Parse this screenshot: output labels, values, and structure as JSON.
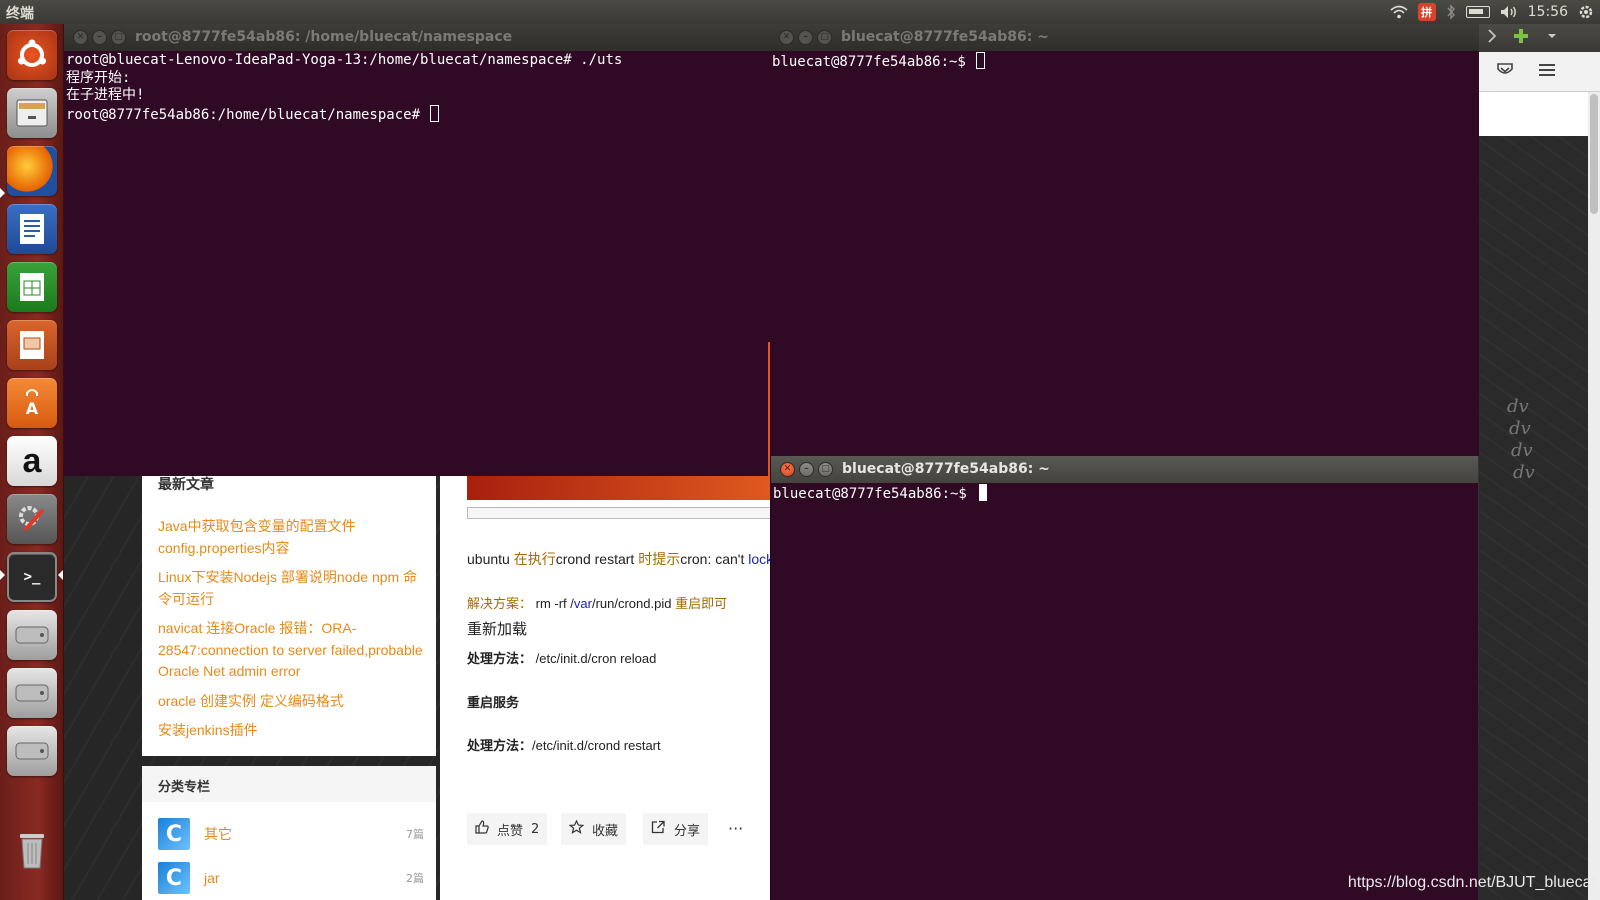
{
  "panel": {
    "app_title": "终端",
    "input_method_label": "拼",
    "clock": "15:56"
  },
  "launcher": {
    "items": [
      {
        "name": "ubuntu-dash",
        "icon": "ubuntu-logo-icon"
      },
      {
        "name": "files",
        "icon": "file-cabinet-icon"
      },
      {
        "name": "firefox",
        "icon": "firefox-icon"
      },
      {
        "name": "writer",
        "icon": "document-icon"
      },
      {
        "name": "calc",
        "icon": "spreadsheet-icon"
      },
      {
        "name": "impress",
        "icon": "presentation-icon"
      },
      {
        "name": "software-center",
        "icon": "shopping-bag-icon"
      },
      {
        "name": "amazon",
        "icon": "amazon-icon",
        "label": "a"
      },
      {
        "name": "settings",
        "icon": "tools-icon"
      },
      {
        "name": "terminal",
        "icon": "terminal-icon",
        "label": ">_"
      },
      {
        "name": "drive-1",
        "icon": "drive-icon"
      },
      {
        "name": "drive-2",
        "icon": "drive-icon"
      },
      {
        "name": "drive-3",
        "icon": "drive-icon"
      },
      {
        "name": "trash",
        "icon": "trash-icon"
      }
    ]
  },
  "terminals": {
    "t1": {
      "title": "root@8777fe54ab86: /home/bluecat/namespace",
      "lines": [
        "root@bluecat-Lenovo-IdeaPad-Yoga-13:/home/bluecat/namespace# ./uts",
        "程序开始:",
        "在子进程中!"
      ],
      "prompt": "root@8777fe54ab86:/home/bluecat/namespace# "
    },
    "t2": {
      "title": "bluecat@8777fe54ab86: ~",
      "prompt": "bluecat@8777fe54ab86:~$ "
    },
    "t3": {
      "title": "bluecat@8777fe54ab86: ~",
      "prompt": "bluecat@8777fe54ab86:~$ "
    }
  },
  "blog": {
    "latest_head": "最新文章",
    "articles": [
      "Java中获取包含变量的配置文件config.properties内容",
      "Linux下安装Nodejs 部署说明node npm 命令可运行",
      "navicat 连接Oracle 报错：ORA-28547:connection to server failed,probable Oracle Net admin error",
      "oracle 创建实例 定义编码格式",
      "安装jenkins插件"
    ],
    "categories_head": "分类专栏",
    "categories": [
      {
        "name": "其它",
        "count": "7篇"
      },
      {
        "name": "jar",
        "count": "2篇"
      }
    ],
    "article": {
      "l1_a": "ubuntu ",
      "l1_b": "在执行",
      "l1_c": "crond restart ",
      "l1_d": "时提示",
      "l1_e": "cron: can't ",
      "l1_f": "lock",
      "l2_a": "解决方案：",
      "l2_b": " rm -rf /",
      "l2_c": "var",
      "l2_d": "/run/crond.pid ",
      "l2_e": "重启即可",
      "l3": "重新加载",
      "l4_a": "处理方法：",
      "l4_b": " /etc/init.d/cron reload",
      "l5": "重启服务",
      "l6_a": "处理方法：",
      "l6_b": "/etc/init.d/crond restart"
    },
    "actions": {
      "like_label": "点赞",
      "like_count": "2",
      "fav_label": "收藏",
      "share_label": "分享",
      "more": "···"
    }
  },
  "watermark": "https://blog.csdn.net/BJUT_bluecat"
}
